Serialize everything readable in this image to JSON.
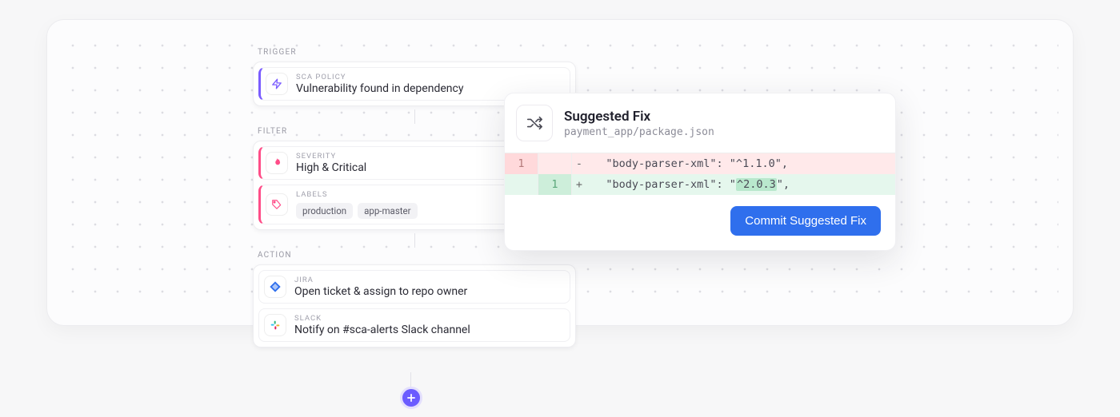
{
  "pipeline": {
    "trigger": {
      "label": "TRIGGER",
      "items": [
        {
          "kicker": "SCA POLICY",
          "text": "Vulnerability found in dependency",
          "icon": "bolt"
        }
      ]
    },
    "filter": {
      "label": "FILTER",
      "items": [
        {
          "kicker": "SEVERITY",
          "text": "High & Critical",
          "icon": "flame"
        },
        {
          "kicker": "LABELS",
          "chips": [
            "production",
            "app-master"
          ],
          "icon": "tag"
        }
      ]
    },
    "action": {
      "label": "ACTION",
      "items": [
        {
          "kicker": "JIRA",
          "text": "Open ticket & assign to repo owner",
          "icon": "jira"
        },
        {
          "kicker": "SLACK",
          "text": "Notify on #sca-alerts Slack channel",
          "icon": "slack"
        }
      ]
    }
  },
  "popup": {
    "title": "Suggested Fix",
    "path": "payment_app/package.json",
    "diff": {
      "removed": {
        "line_old": "1",
        "line_new": "",
        "code": "   \"body-parser-xml\": \"^1.1.0\","
      },
      "added": {
        "line_old": "",
        "line_new": "1",
        "code_pre": "   \"body-parser-xml\": \"",
        "code_hl": "^2.0.3",
        "code_post": "\","
      }
    },
    "button": "Commit Suggested Fix"
  }
}
